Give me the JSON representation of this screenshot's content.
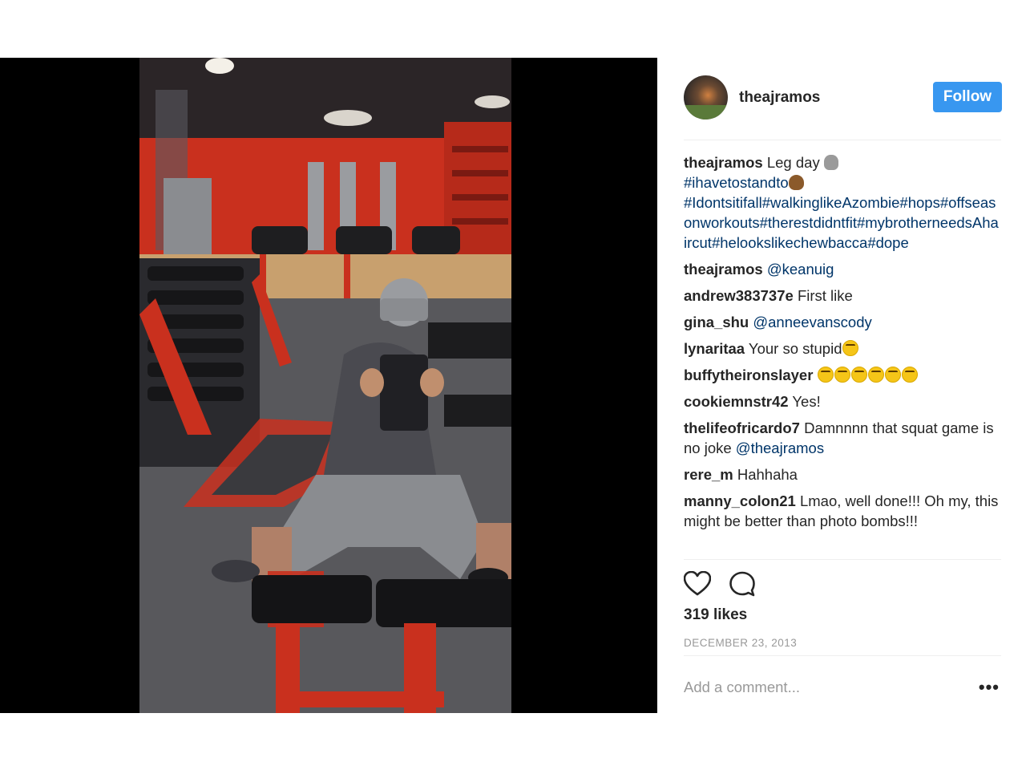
{
  "post": {
    "username": "theajramos",
    "follow_label": "Follow",
    "caption": {
      "username": "theajramos",
      "text": "Leg day",
      "line2": "#ihavetostandto",
      "hashtags": "#Idontsitifall#walkinglikeAzombie#hops#offseasonworkouts#therestdidntfit#mybrotherneedsAhaircut#helookslikechewbacca#dope"
    },
    "comments": [
      {
        "user": "theajramos",
        "text": "@keanuig"
      },
      {
        "user": "andrew383737e",
        "text": "First like"
      },
      {
        "user": "gina_shu",
        "text": "@anneevanscody"
      },
      {
        "user": "lynaritaa",
        "text": "Your so stupid"
      },
      {
        "user": "buffytheironslayer",
        "text": ""
      },
      {
        "user": "cookiemnstr42",
        "text": "Yes!"
      },
      {
        "user": "thelifeofricardo7",
        "text": "Damnnnn that squat game is no joke ",
        "mention": "@theajramos"
      },
      {
        "user": "rere_m",
        "text": "Hahhaha"
      },
      {
        "user": "manny_colon21",
        "text": "Lmao, well done!!! Oh my, this might be better than photo bombs!!!"
      }
    ],
    "likes": "319 likes",
    "date": "DECEMBER 23, 2013",
    "add_comment_placeholder": "Add a comment...",
    "more_label": "•••",
    "icons": [
      "heart-icon",
      "comment-icon",
      "more-options-icon",
      "skull-emoji",
      "poop-emoji",
      "laughing-emoji"
    ],
    "colors": {
      "follow": "#3897f0",
      "link": "#003569",
      "muted": "#999999"
    }
  }
}
